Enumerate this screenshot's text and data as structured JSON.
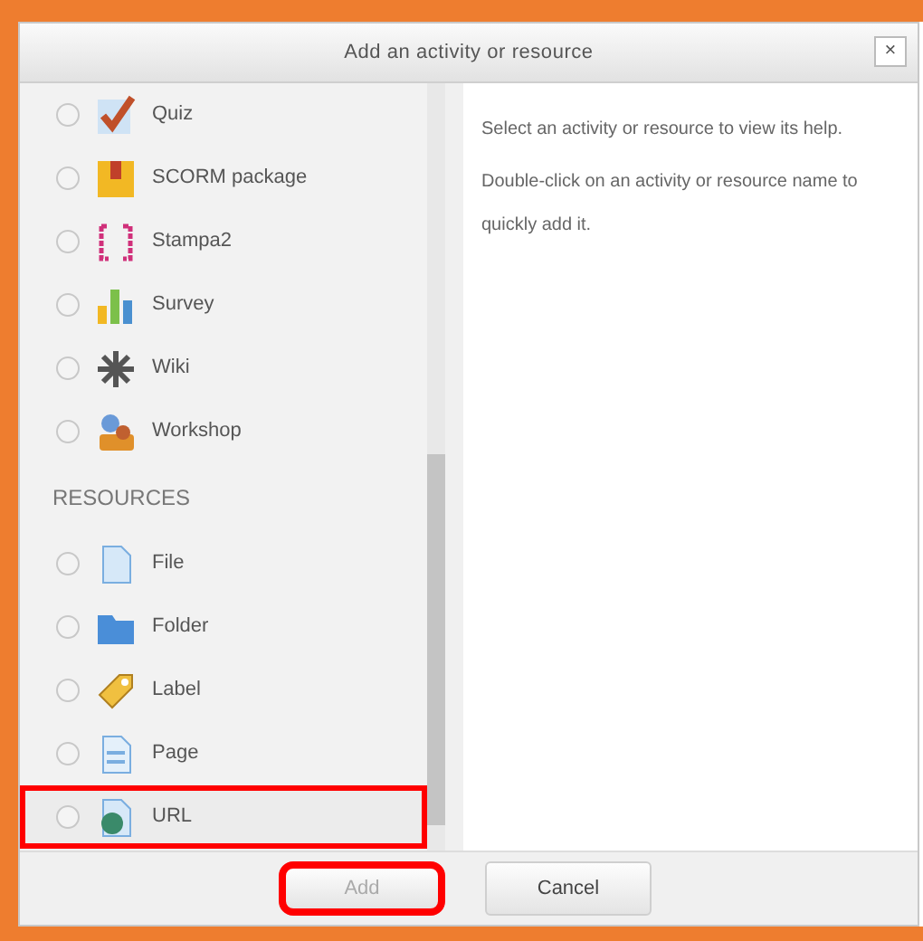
{
  "dialog": {
    "title": "Add an activity or resource",
    "close": "×"
  },
  "activities": [
    {
      "label": "Quiz",
      "selected": false,
      "highlighted": false
    },
    {
      "label": "SCORM package",
      "selected": false,
      "highlighted": false
    },
    {
      "label": "Stampa2",
      "selected": false,
      "highlighted": false
    },
    {
      "label": "Survey",
      "selected": false,
      "highlighted": false
    },
    {
      "label": "Wiki",
      "selected": false,
      "highlighted": false
    },
    {
      "label": "Workshop",
      "selected": false,
      "highlighted": false
    }
  ],
  "resources_heading": "RESOURCES",
  "resources": [
    {
      "label": "File",
      "selected": false,
      "highlighted": false
    },
    {
      "label": "Folder",
      "selected": false,
      "highlighted": false
    },
    {
      "label": "Label",
      "selected": false,
      "highlighted": false
    },
    {
      "label": "Page",
      "selected": false,
      "highlighted": false
    },
    {
      "label": "URL",
      "selected": false,
      "highlighted": true
    }
  ],
  "help": [
    "Select an activity or resource to view its help.",
    "Double-click on an activity or resource name to quickly add it."
  ],
  "buttons": [
    {
      "label": "Add",
      "disabled": true,
      "highlighted": true
    },
    {
      "label": "Cancel",
      "disabled": false,
      "highlighted": false
    }
  ]
}
